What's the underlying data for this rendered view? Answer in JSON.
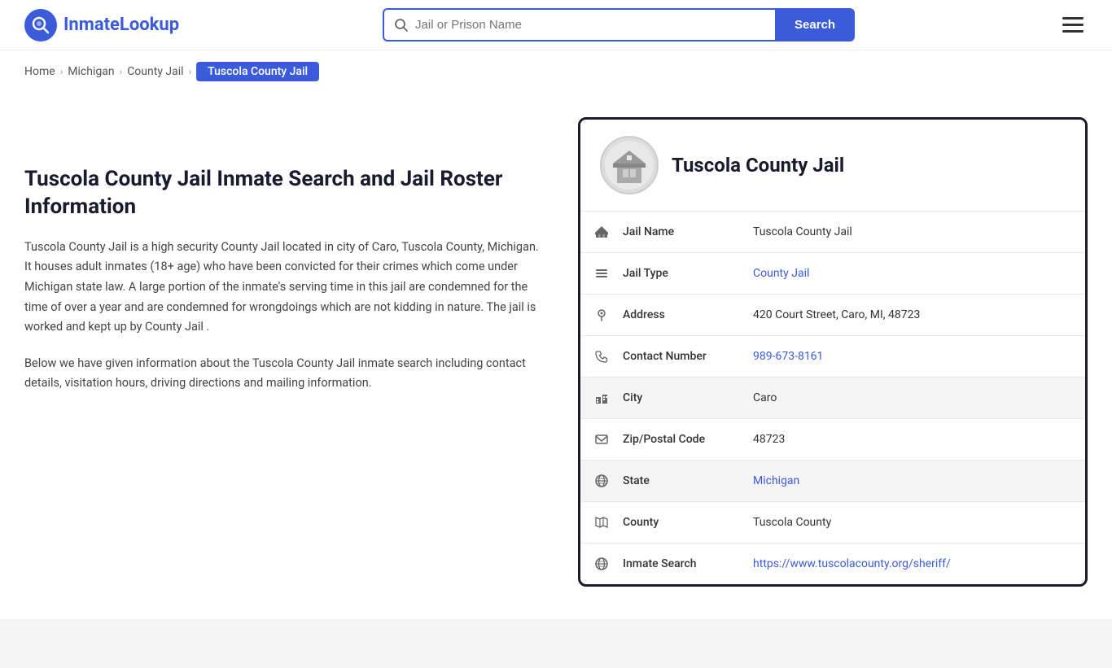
{
  "logo": {
    "icon_symbol": "Q",
    "brand_name_part1": "Inmate",
    "brand_name_part2": "Lookup"
  },
  "search": {
    "placeholder": "Jail or Prison Name",
    "button_label": "Search"
  },
  "hamburger_label": "Menu",
  "breadcrumb": {
    "items": [
      {
        "label": "Home",
        "href": "#"
      },
      {
        "label": "Michigan",
        "href": "#"
      },
      {
        "label": "County Jail",
        "href": "#"
      },
      {
        "label": "Tuscola County Jail",
        "current": true
      }
    ]
  },
  "main": {
    "heading": "Tuscola County Jail Inmate Search and Jail Roster Information",
    "description1": "Tuscola County Jail is a high security County Jail located in city of Caro, Tuscola County, Michigan. It houses adult inmates (18+ age) who have been convicted for their crimes which come under Michigan state law. A large portion of the inmate's serving time in this jail are condemned for the time of over a year and are condemned for wrongdoings which are not kidding in nature. The jail is worked and kept up by County Jail .",
    "description2": "Below we have given information about the Tuscola County Jail inmate search including contact details, visitation hours, driving directions and mailing information."
  },
  "jail_card": {
    "title": "Tuscola County Jail",
    "avatar_emoji": "🏛️",
    "fields": [
      {
        "icon": "🏛",
        "label": "Jail Name",
        "value": "Tuscola County Jail",
        "link": null,
        "shaded": false
      },
      {
        "icon": "≡",
        "label": "Jail Type",
        "value": "County Jail",
        "link": "#",
        "shaded": false
      },
      {
        "icon": "📍",
        "label": "Address",
        "value": "420 Court Street, Caro, MI, 48723",
        "link": null,
        "shaded": false
      },
      {
        "icon": "📞",
        "label": "Contact Number",
        "value": "989-673-8161",
        "link": "tel:989-673-8161",
        "shaded": false
      },
      {
        "icon": "🏙",
        "label": "City",
        "value": "Caro",
        "link": null,
        "shaded": true
      },
      {
        "icon": "✉",
        "label": "Zip/Postal Code",
        "value": "48723",
        "link": null,
        "shaded": false
      },
      {
        "icon": "🌐",
        "label": "State",
        "value": "Michigan",
        "link": "#",
        "shaded": true
      },
      {
        "icon": "🗺",
        "label": "County",
        "value": "Tuscola County",
        "link": null,
        "shaded": false
      },
      {
        "icon": "🌐",
        "label": "Inmate Search",
        "value": "https://www.tuscolacounty.org/sheriff/",
        "link": "https://www.tuscolacounty.org/sheriff/",
        "shaded": false
      }
    ]
  }
}
